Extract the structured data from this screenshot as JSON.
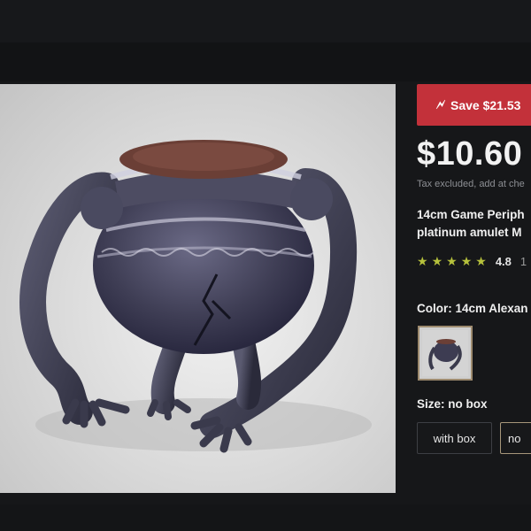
{
  "product": {
    "save_label": "Save $21.53",
    "price": "$10.60",
    "tax_note": "Tax excluded, add at che",
    "title_line1": "14cm Game Periph",
    "title_line2": "platinum amulet M",
    "rating_value": "4.8",
    "rating_count": "1",
    "rating_stars": 5,
    "color_label": "Color: 14cm Alexan",
    "size_label": "Size: no box",
    "size_options": [
      {
        "label": "with box",
        "selected": false
      },
      {
        "label": "no",
        "selected": true
      }
    ]
  },
  "icons": {
    "bolt": "bolt-icon",
    "star": "star-icon"
  },
  "colors": {
    "accent_red": "#c3313a",
    "star": "#b6c13c",
    "selected_border": "#a6967a",
    "background": "#141517"
  }
}
